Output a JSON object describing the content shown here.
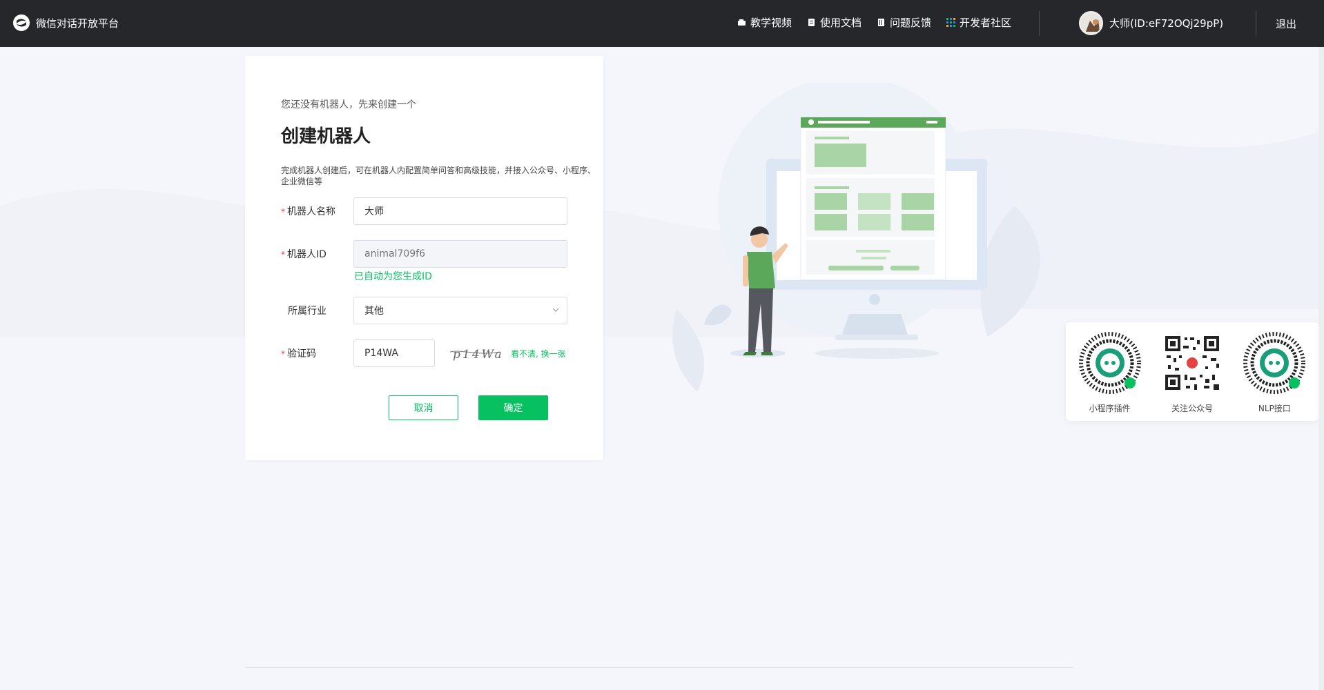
{
  "header": {
    "app_title": "微信对话开放平台",
    "nav": [
      {
        "label": "教学视频",
        "icon": "video-icon"
      },
      {
        "label": "使用文档",
        "icon": "document-icon"
      },
      {
        "label": "问题反馈",
        "icon": "feedback-icon"
      },
      {
        "label": "开发者社区",
        "icon": "community-grid-icon"
      }
    ],
    "user_name": "大师(ID:eF72OQj29pP)",
    "logout_label": "退出"
  },
  "form": {
    "subtitle": "您还没有机器人，先来创建一个",
    "title": "创建机器人",
    "description": "完成机器人创建后，可在机器人内配置简单问答和高级技能，并接入公众号、小程序、企业微信等",
    "required_mark": "*",
    "name_label": "机器人名称",
    "name_value": "大师",
    "id_label": "机器人ID",
    "id_placeholder": "animal709f6",
    "id_hint": "已自动为您生成ID",
    "industry_label": "所属行业",
    "industry_value": "其他",
    "captcha_label": "验证码",
    "captcha_value": "P14WA",
    "captcha_image_text": "p14Wa",
    "captcha_refresh": "看不清, 换一张",
    "cancel_label": "取消",
    "confirm_label": "确定"
  },
  "qr_codes": [
    {
      "label": "小程序插件"
    },
    {
      "label": "关注公众号"
    },
    {
      "label": "NLP接口"
    }
  ],
  "colors": {
    "accent": "#07c160",
    "topbar": "#25272b",
    "background": "#f4f6fb"
  }
}
